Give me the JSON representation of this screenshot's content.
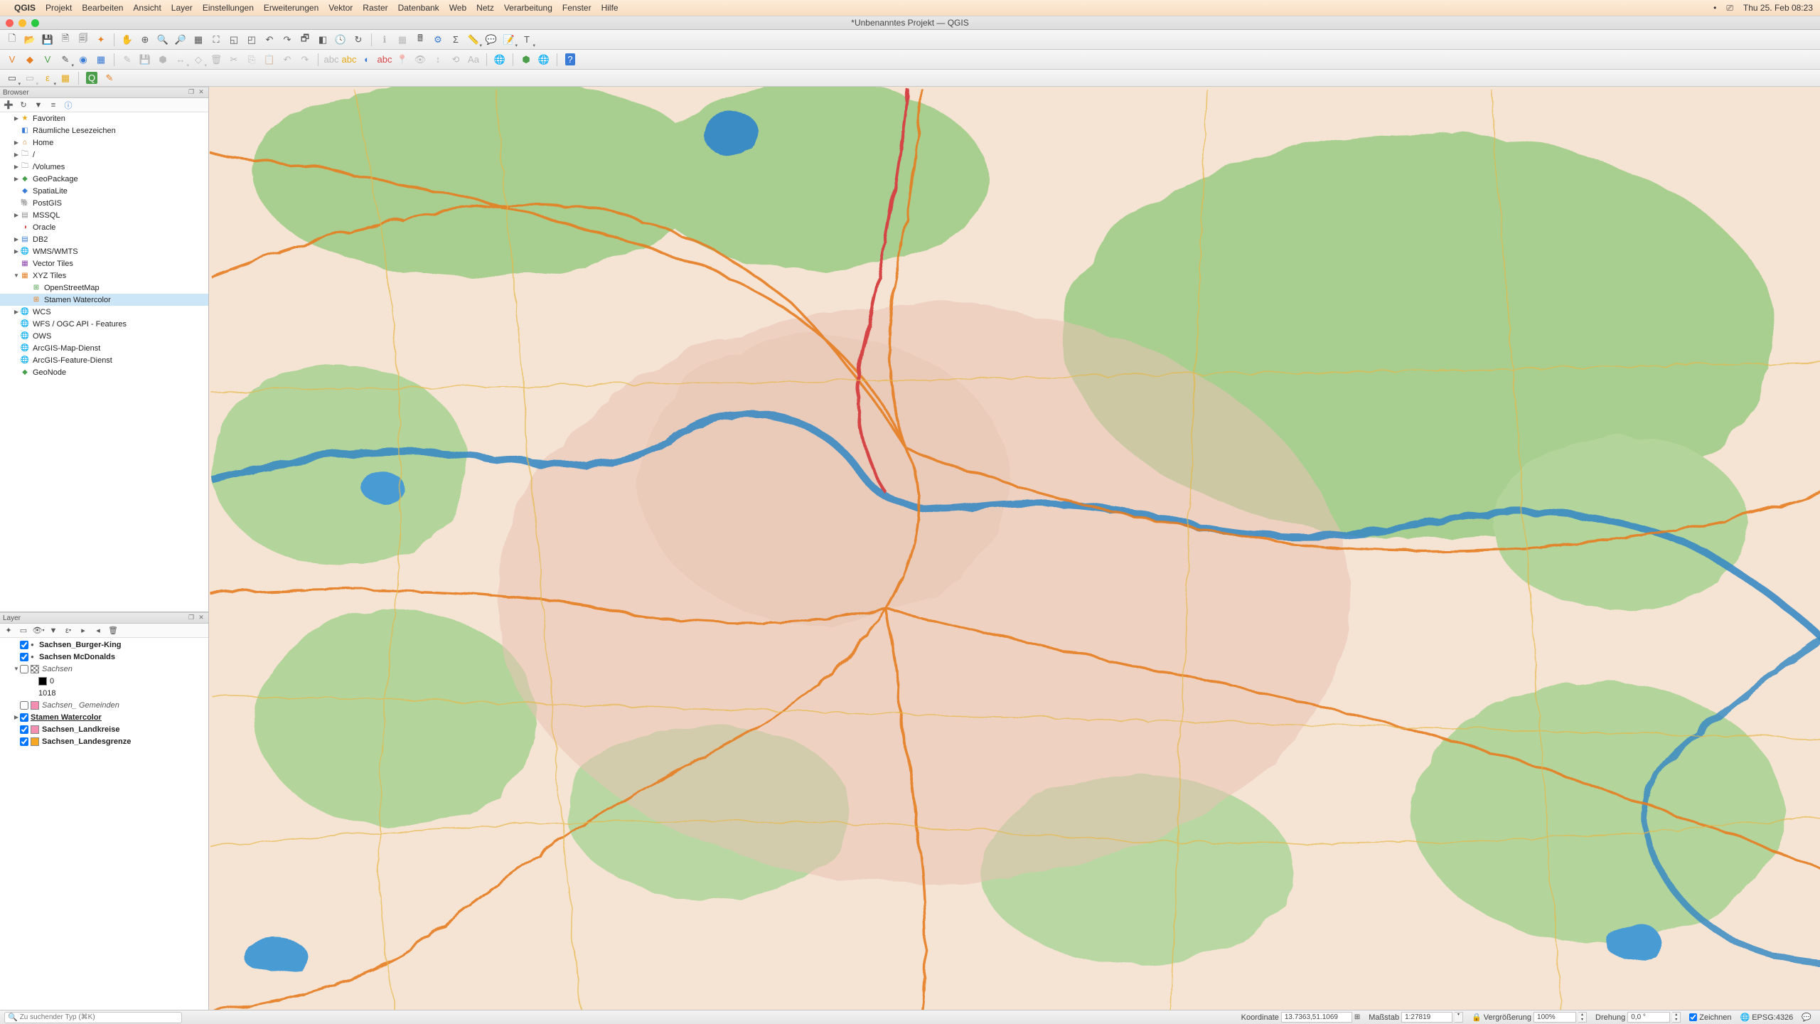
{
  "mac_menu": {
    "app": "QGIS",
    "items": [
      "Projekt",
      "Bearbeiten",
      "Ansicht",
      "Layer",
      "Einstellungen",
      "Erweiterungen",
      "Vektor",
      "Raster",
      "Datenbank",
      "Web",
      "Netz",
      "Verarbeitung",
      "Fenster",
      "Hilfe"
    ],
    "clock": "Thu 25. Feb  08:23"
  },
  "window": {
    "title": "*Unbenanntes Projekt — QGIS"
  },
  "browser": {
    "title": "Browser",
    "items": [
      {
        "label": "Favoriten",
        "icon": "★",
        "iconClass": "ic-yellow",
        "arrow": "▶"
      },
      {
        "label": "Räumliche Lesezeichen",
        "icon": "◧",
        "iconClass": "ic-blue",
        "arrow": ""
      },
      {
        "label": "Home",
        "icon": "⌂",
        "iconClass": "ic-orange",
        "arrow": "▶"
      },
      {
        "label": "/",
        "icon": "🗀",
        "iconClass": "ic-gray",
        "arrow": "▶"
      },
      {
        "label": "/Volumes",
        "icon": "🗀",
        "iconClass": "ic-gray",
        "arrow": "▶"
      },
      {
        "label": "GeoPackage",
        "icon": "◆",
        "iconClass": "ic-green",
        "arrow": "▶"
      },
      {
        "label": "SpatiaLite",
        "icon": "◆",
        "iconClass": "ic-blue",
        "arrow": ""
      },
      {
        "label": "PostGIS",
        "icon": "🐘",
        "iconClass": "ic-blue",
        "arrow": ""
      },
      {
        "label": "MSSQL",
        "icon": "▤",
        "iconClass": "ic-gray",
        "arrow": "▶"
      },
      {
        "label": "Oracle",
        "icon": "◑",
        "iconClass": "ic-red",
        "arrow": ""
      },
      {
        "label": "DB2",
        "icon": "▤",
        "iconClass": "ic-blue",
        "arrow": "▶"
      },
      {
        "label": "WMS/WMTS",
        "icon": "🌐",
        "iconClass": "ic-green",
        "arrow": "▶"
      },
      {
        "label": "Vector Tiles",
        "icon": "▦",
        "iconClass": "ic-purple",
        "arrow": ""
      },
      {
        "label": "XYZ Tiles",
        "icon": "▦",
        "iconClass": "ic-orange",
        "arrow": "▼",
        "expanded": true
      },
      {
        "label": "OpenStreetMap",
        "icon": "⊞",
        "iconClass": "ic-green",
        "arrow": "",
        "indent": 2
      },
      {
        "label": "Stamen Watercolor",
        "icon": "⊞",
        "iconClass": "ic-orange",
        "arrow": "",
        "indent": 2,
        "selected": true
      },
      {
        "label": "WCS",
        "icon": "🌐",
        "iconClass": "ic-blue",
        "arrow": "▶"
      },
      {
        "label": "WFS / OGC API - Features",
        "icon": "🌐",
        "iconClass": "ic-green",
        "arrow": ""
      },
      {
        "label": "OWS",
        "icon": "🌐",
        "iconClass": "ic-blue",
        "arrow": ""
      },
      {
        "label": "ArcGIS-Map-Dienst",
        "icon": "🌐",
        "iconClass": "ic-blue",
        "arrow": ""
      },
      {
        "label": "ArcGIS-Feature-Dienst",
        "icon": "🌐",
        "iconClass": "ic-blue",
        "arrow": ""
      },
      {
        "label": "GeoNode",
        "icon": "◆",
        "iconClass": "ic-green",
        "arrow": ""
      }
    ]
  },
  "layers": {
    "title": "Layer",
    "rows": [
      {
        "arrow": "",
        "check": true,
        "dot": true,
        "label": "Sachsen_Burger-King",
        "bold": true
      },
      {
        "arrow": "",
        "check": true,
        "dot": true,
        "label": "Sachsen McDonalds",
        "bold": true
      },
      {
        "arrow": "▼",
        "check": false,
        "swatch": "checker",
        "label": "Sachsen",
        "italic": true
      },
      {
        "arrow": "",
        "indent": 2,
        "swatch": "#000000",
        "label": "0"
      },
      {
        "arrow": "",
        "indent": 2,
        "swatch": "",
        "label": "1018"
      },
      {
        "arrow": "",
        "check": false,
        "swatch": "#f48fb1",
        "label": "Sachsen_ Gemeinden",
        "italic": true
      },
      {
        "arrow": "▶",
        "check": true,
        "label": "Stamen Watercolor",
        "bold": true,
        "underline": true
      },
      {
        "arrow": "",
        "check": true,
        "swatch": "#f48fb1",
        "label": "Sachsen_Landkreise",
        "bold": true
      },
      {
        "arrow": "",
        "check": true,
        "swatch": "#f5a623",
        "label": "Sachsen_Landesgrenze",
        "bold": true
      }
    ]
  },
  "statusbar": {
    "search_placeholder": "Zu suchender Typ (⌘K)",
    "coord_label": "Koordinate",
    "coord_value": "13.7363,51.1069",
    "scale_label": "Maßstab",
    "scale_value": "1:27819",
    "lock_icon": "🔒",
    "mag_label": "Vergrößerung",
    "mag_value": "100%",
    "rot_label": "Drehung",
    "rot_value": "0,0 °",
    "render_label": "Zeichnen",
    "crs_value": "EPSG:4326"
  }
}
